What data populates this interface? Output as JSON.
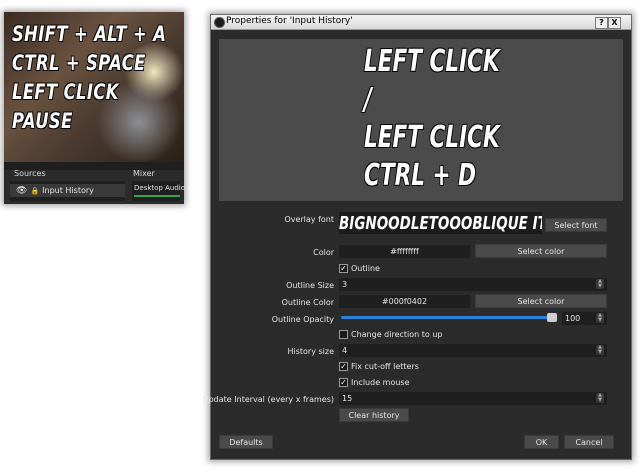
{
  "main_window": {
    "preview_lines": [
      "SHIFT + ALT + A",
      "CTRL + SPACE",
      "LEFT CLICK",
      "PAUSE"
    ],
    "sources_title": "Sources",
    "mixer_title": "Mixer",
    "source_item": "Input History",
    "mixer_item": "Desktop Audio"
  },
  "dialog": {
    "title": "Properties for 'Input History'",
    "help_button": "?",
    "close_button": "X",
    "preview_lines": [
      "LEFT CLICK",
      "/",
      "LEFT CLICK",
      "CTRL + D"
    ],
    "overlay_font": {
      "label": "Overlay font",
      "value": "BIGNOODLETOOOBLIQUE ITALIC",
      "button": "Select font"
    },
    "color": {
      "label": "Color",
      "value": "#ffffffff",
      "button": "Select color"
    },
    "outline": {
      "label": "Outline",
      "checked": true
    },
    "outline_size": {
      "label": "Outline Size",
      "value": "3"
    },
    "outline_color": {
      "label": "Outline Color",
      "value": "#000f0402",
      "button": "Select color"
    },
    "outline_opacity": {
      "label": "Outline Opacity",
      "value": "100",
      "level_percent": 100
    },
    "change_direction": {
      "label": "Change direction to up",
      "checked": false
    },
    "history_size": {
      "label": "History size",
      "value": "4"
    },
    "fix_cutoff": {
      "label": "Fix cut-off letters",
      "checked": true
    },
    "include_mouse": {
      "label": "Include mouse",
      "checked": true
    },
    "update_interval": {
      "label": "Update Interval (every x frames)",
      "value": "15"
    },
    "clear_history_button": "Clear history",
    "defaults_button": "Defaults",
    "ok_button": "OK",
    "cancel_button": "Cancel"
  },
  "colors": {
    "panel_bg": "#2b2b2b",
    "field_bg": "#1f1f1f",
    "button_bg": "#4a4a4a",
    "accent": "#2a82da",
    "meter": "#2fa84f"
  }
}
